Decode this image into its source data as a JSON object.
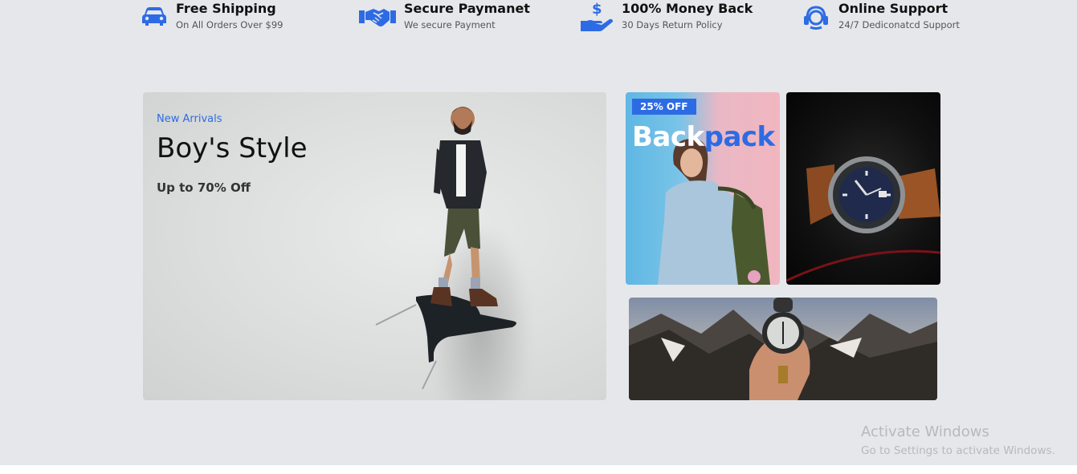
{
  "features": [
    {
      "title": "Free Shipping",
      "subtitle": "On All Orders Over $99",
      "icon": "car-icon"
    },
    {
      "title": "Secure Paymanet",
      "subtitle": "We secure Payment",
      "icon": "handshake-icon"
    },
    {
      "title": "100% Money Back",
      "subtitle": "30 Days Return Policy",
      "icon": "dollar-hand-icon"
    },
    {
      "title": "Online Support",
      "subtitle": "24/7 Dediconatcd Support",
      "icon": "headset-icon"
    }
  ],
  "hero": {
    "eyebrow": "New Arrivals",
    "title": "Boy's Style",
    "subtitle": "Up to 70% Off"
  },
  "backpack": {
    "badge": "25% OFF",
    "headline_part1": "Back",
    "headline_part2": "pack"
  },
  "windows_watermark": {
    "title": "Activate Windows",
    "subtitle": "Go to Settings to activate Windows."
  },
  "colors": {
    "accent": "#2d6be4",
    "background": "#e6e7ea"
  }
}
